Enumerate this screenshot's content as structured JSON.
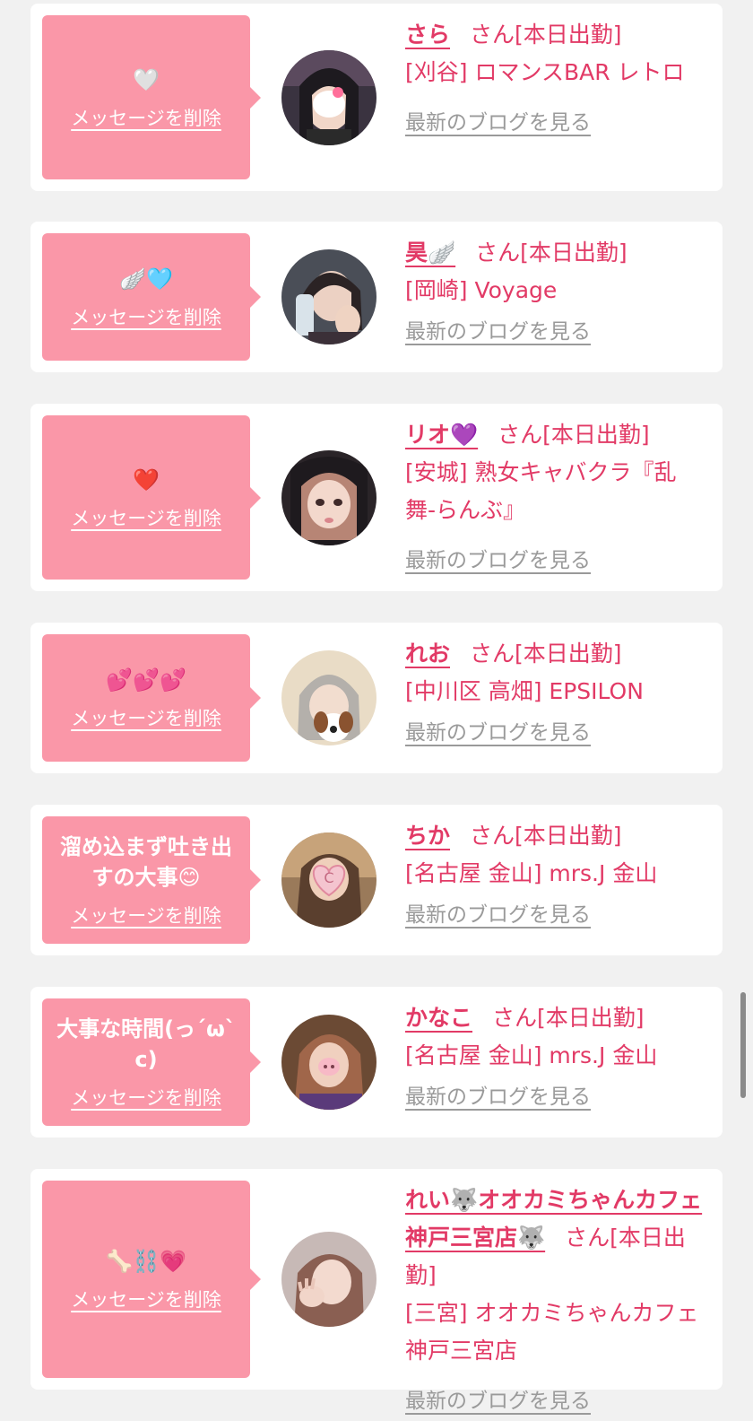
{
  "delete_label": "メッセージを削除",
  "san_label": "さん[本日出勤]",
  "san_plain": "さん",
  "blog_label": "最新のブログを見る",
  "colors": {
    "page_bg": "#f1f1f1",
    "card_bg": "#ffffff",
    "bubble": "#fa97a8",
    "accent_text": "#e23a66",
    "link_gray": "#9a9a9a"
  },
  "cards": [
    {
      "message": "🤍",
      "name": "さら",
      "shop": "[刈谷] ロマンスBAR レトロ",
      "avatar_icon": "profile-photo-icon"
    },
    {
      "message": "🪽🩵",
      "name": "昊🪽",
      "shop": "[岡崎] Voyage",
      "avatar_icon": "profile-photo-icon"
    },
    {
      "message": "❤️",
      "name": "リオ💜",
      "shop": "[安城] 熟女キャバクラ『乱舞-らんぶ』",
      "avatar_icon": "profile-photo-icon"
    },
    {
      "message": "💕💕💕",
      "name": "れお",
      "shop": "[中川区 高畑] EPSILON",
      "avatar_icon": "profile-photo-icon"
    },
    {
      "message": "溜め込まず吐き出すの大事😊",
      "name": "ちか",
      "shop": "[名古屋 金山] mrs.J 金山",
      "avatar_icon": "profile-photo-icon"
    },
    {
      "message": "大事な時間(っˊωˋc)",
      "name": "かなこ",
      "shop": "[名古屋 金山] mrs.J 金山",
      "avatar_icon": "profile-photo-icon"
    },
    {
      "message": "🦴⛓️💗",
      "name": "れい🐺オオカミちゃんカフェ神戸三宮店🐺",
      "shop": "[三宮] オオカミちゃんカフェ神戸三宮店",
      "avatar_icon": "profile-photo-icon"
    }
  ],
  "last_card_status": "[本日出勤]"
}
